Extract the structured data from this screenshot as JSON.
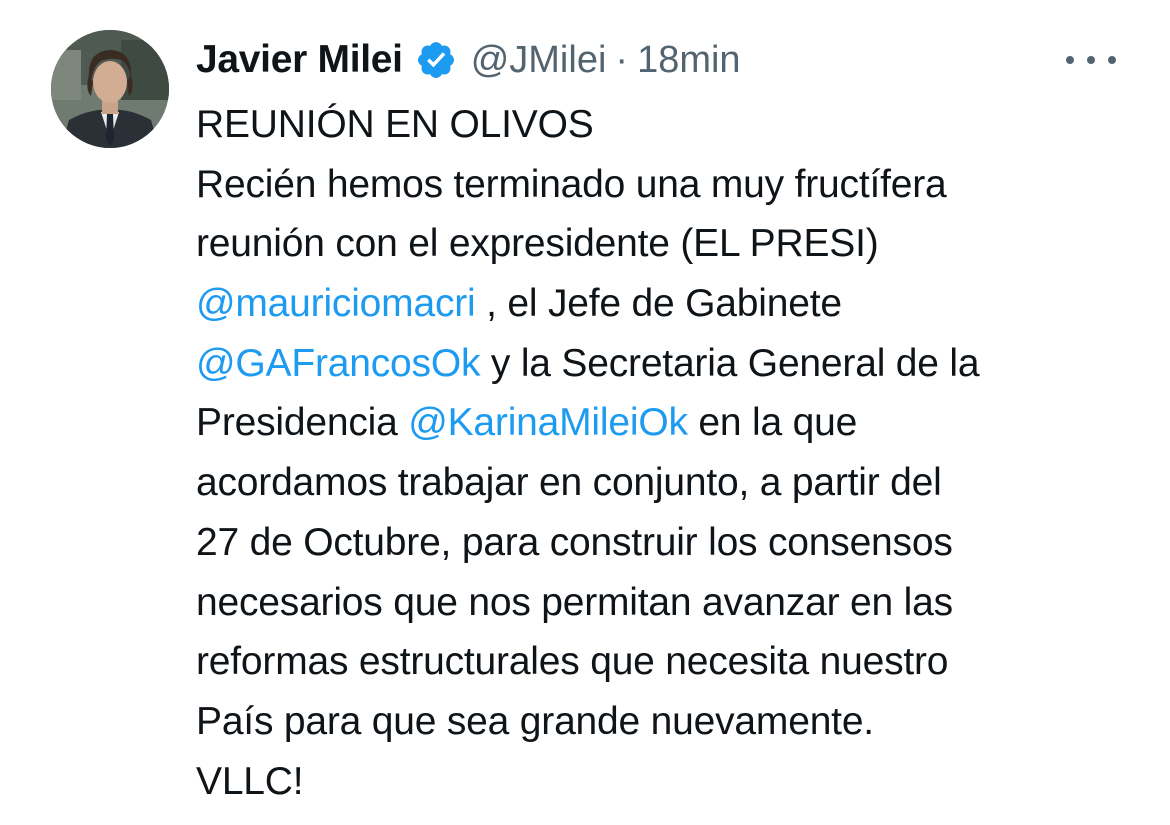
{
  "author": {
    "display_name": "Javier Milei",
    "handle": "@JMilei",
    "separator": "·",
    "time": "18min",
    "verified_icon": "verified-badge-icon",
    "avatar_alt": "profile photo"
  },
  "more_icon": "more-options-icon",
  "colors": {
    "text": "#0f1419",
    "secondary": "#536471",
    "mention": "#1d9bf0",
    "badge": "#1d9bf0"
  },
  "tweet": {
    "line1": "REUNIÓN EN OLIVOS",
    "line2": "Recién hemos terminado una muy fructífera",
    "line3": "reunión con el expresidente (EL PRESI)",
    "line4_mention": "@mauriciomacri",
    "line4_rest": " , el Jefe de Gabinete",
    "line5_mention": "@GAFrancosOk",
    "line5_rest": " y la Secretaria General de la",
    "line6_pre": "Presidencia ",
    "line6_mention": "@KarinaMileiOk",
    "line6_rest": " en la que",
    "line7": "acordamos trabajar en conjunto, a partir del",
    "line8": "27 de Octubre, para construir los consensos",
    "line9": "necesarios que nos permitan avanzar en las",
    "line10": "reformas estructurales que necesita nuestro",
    "line11": "País para que sea grande nuevamente.",
    "line12": "VLLC!"
  }
}
